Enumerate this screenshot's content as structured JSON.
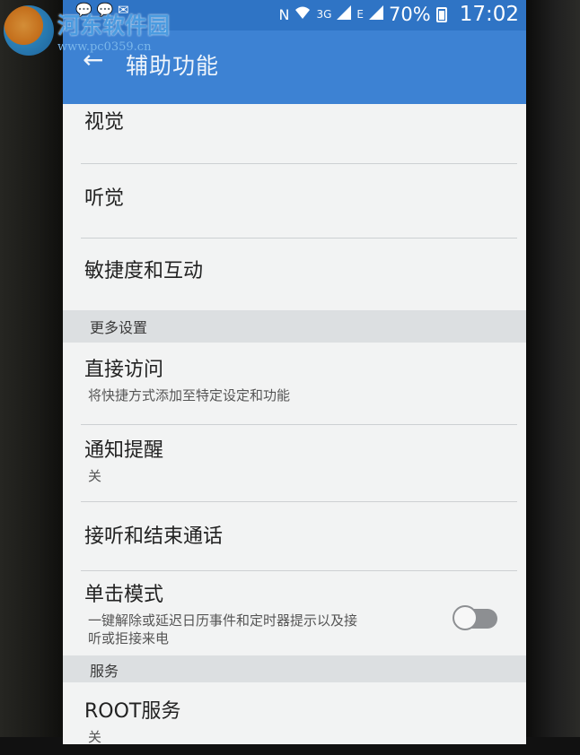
{
  "status_bar": {
    "battery_percent": "70%",
    "time": "17:02",
    "left_icons": [
      "chat-icon",
      "chat-icon",
      "mail-icon"
    ],
    "network_labels": [
      "N",
      "3G",
      "E"
    ]
  },
  "action_bar": {
    "title": "辅助功能"
  },
  "list": {
    "vision": "视觉",
    "hearing": "听觉",
    "dexterity": "敏捷度和互动"
  },
  "more_settings": {
    "header": "更多设置",
    "direct_access": {
      "title": "直接访问",
      "subtitle": "将快捷方式添加至特定设定和功能"
    },
    "notification_reminder": {
      "title": "通知提醒",
      "value": "关"
    },
    "answer_end_calls": {
      "title": "接听和结束通话"
    },
    "single_tap_mode": {
      "title": "单击模式",
      "subtitle_line1": "一键解除或延迟日历事件和定时器提示以及接",
      "subtitle_line2": "听或拒接来电",
      "enabled": false
    }
  },
  "services": {
    "header": "服务",
    "root_service": {
      "title": "ROOT服务",
      "value": "关"
    }
  },
  "watermark": {
    "name": "河东软件园",
    "url": "www.pc0359.cn"
  },
  "colors": {
    "status_bar": "#2f74c5",
    "action_bar": "#3d82d3",
    "background": "#f2f3f3",
    "section_header": "#dcdfe1"
  }
}
